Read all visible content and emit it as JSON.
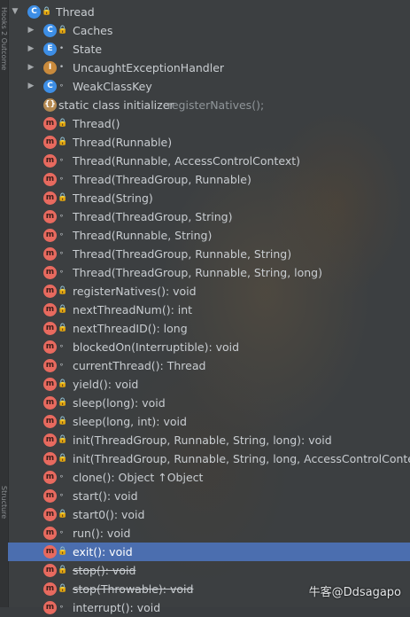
{
  "gutter": {
    "text_top": "Hooks 2 Outcome",
    "text_bottom": "Structure"
  },
  "tree": {
    "root": {
      "label": "Thread",
      "icon": "class-icon"
    },
    "nested": [
      {
        "label": "Caches",
        "icon": "class-icon"
      },
      {
        "label": "State",
        "icon": "enum-icon"
      },
      {
        "label": "UncaughtExceptionHandler",
        "icon": "interface-icon"
      },
      {
        "label": "WeakClassKey",
        "icon": "class-icon"
      }
    ],
    "initializer": {
      "label": "static class initializer",
      "detail": "registerNatives();"
    },
    "members": [
      {
        "label": "Thread()"
      },
      {
        "label": "Thread(Runnable)"
      },
      {
        "label": "Thread(Runnable, AccessControlContext)"
      },
      {
        "label": "Thread(ThreadGroup, Runnable)"
      },
      {
        "label": "Thread(String)"
      },
      {
        "label": "Thread(ThreadGroup, String)"
      },
      {
        "label": "Thread(Runnable, String)"
      },
      {
        "label": "Thread(ThreadGroup, Runnable, String)"
      },
      {
        "label": "Thread(ThreadGroup, Runnable, String, long)"
      },
      {
        "label": "registerNatives(): void"
      },
      {
        "label": "nextThreadNum(): int"
      },
      {
        "label": "nextThreadID(): long"
      },
      {
        "label": "blockedOn(Interruptible): void"
      },
      {
        "label": "currentThread(): Thread"
      },
      {
        "label": "yield(): void"
      },
      {
        "label": "sleep(long): void"
      },
      {
        "label": "sleep(long, int): void"
      },
      {
        "label": "init(ThreadGroup, Runnable, String, long): void"
      },
      {
        "label": "init(ThreadGroup, Runnable, String, long, AccessControlContext,"
      },
      {
        "label": "clone(): Object ↑Object"
      },
      {
        "label": "start(): void"
      },
      {
        "label": "start0(): void"
      },
      {
        "label": "run(): void"
      },
      {
        "label": "exit(): void"
      },
      {
        "label": "stop(): void"
      },
      {
        "label": "stop(Throwable): void"
      },
      {
        "label": "interrupt(): void"
      }
    ]
  },
  "watermark": "牛客@Ddsagapo",
  "colors": {
    "selection": "#4b6eaf",
    "method_icon": "#e86a5f",
    "class_icon": "#3d8ee6",
    "lock": "#d6a33a"
  }
}
